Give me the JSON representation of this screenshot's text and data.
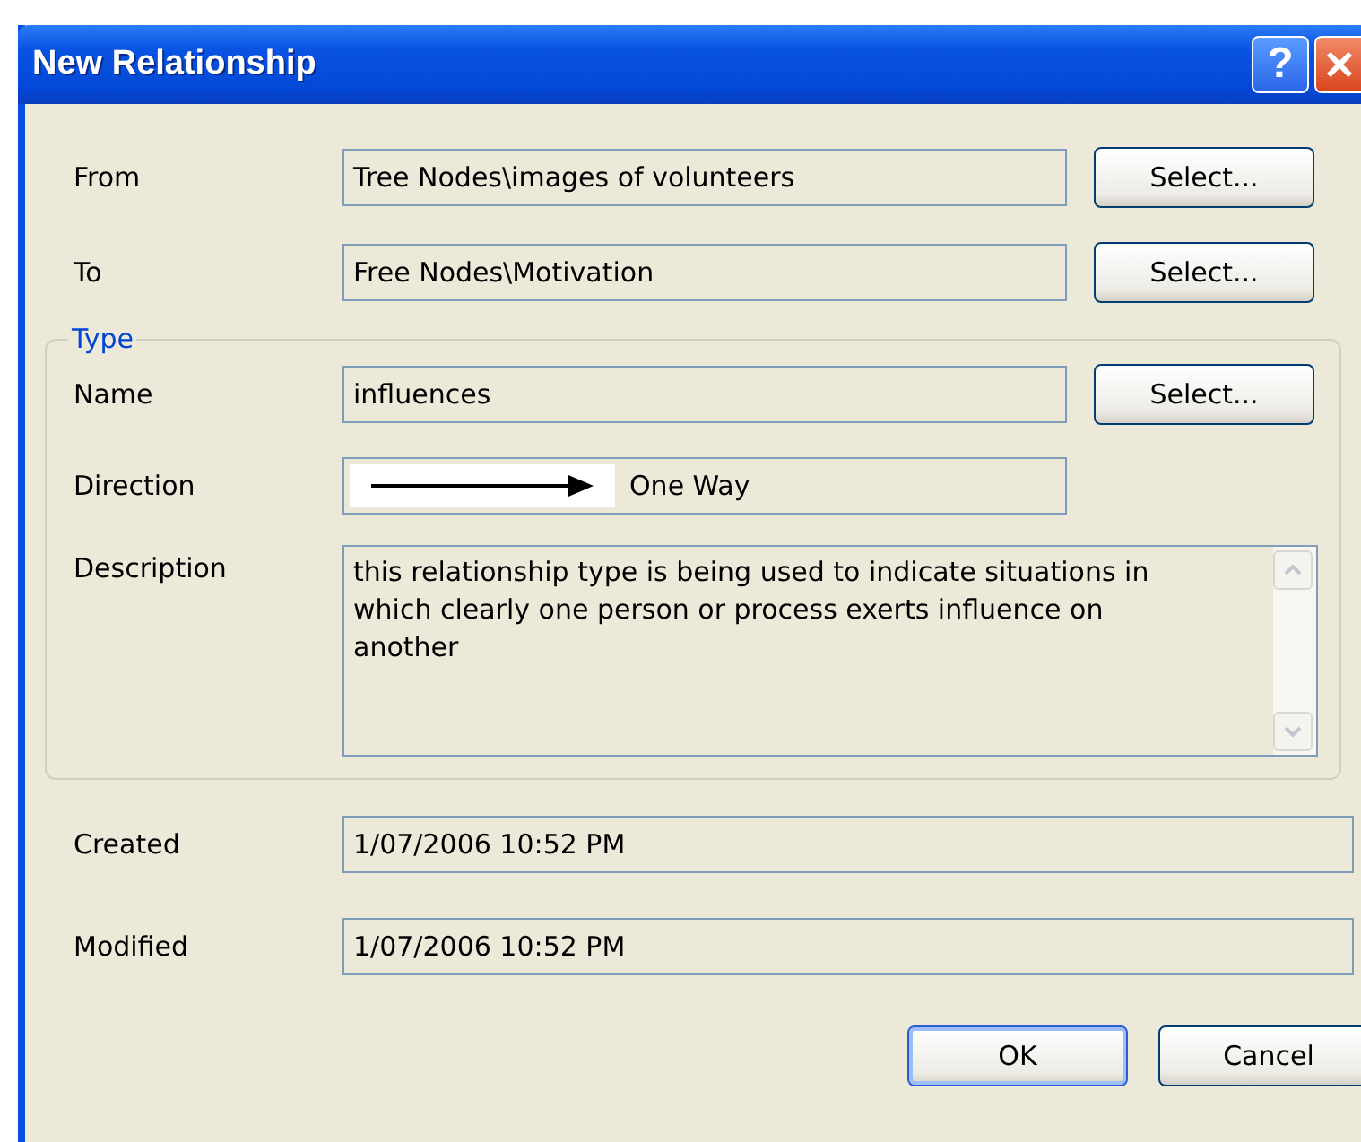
{
  "window": {
    "title": "New Relationship",
    "help_button": "?"
  },
  "top_rows": [
    {
      "label": "From",
      "value": "Tree Nodes\\images of volunteers",
      "button": "Select..."
    },
    {
      "label": "To",
      "value": "Free Nodes\\Motivation",
      "button": "Select..."
    }
  ],
  "type_group": {
    "legend": "Type",
    "name": {
      "label": "Name",
      "value": "influences",
      "button": "Select..."
    },
    "direction": {
      "label": "Direction",
      "value": "One Way"
    },
    "description": {
      "label": "Description",
      "value": "this relationship type is being used to indicate situations in which clearly one person or process exerts influence on another"
    }
  },
  "bottom_rows": [
    {
      "label": "Created",
      "value": "1/07/2006 10:52 PM"
    },
    {
      "label": "Modified",
      "value": "1/07/2006 10:52 PM"
    }
  ],
  "buttons": [
    {
      "label": "OK",
      "default": true
    },
    {
      "label": "Cancel",
      "default": false
    }
  ]
}
